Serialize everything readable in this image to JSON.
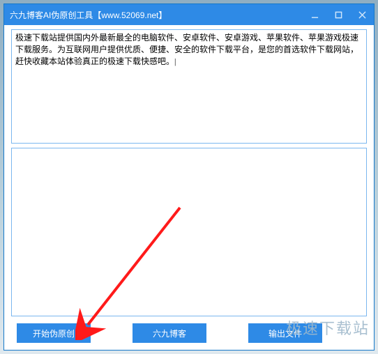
{
  "window": {
    "title": "六九博客AI伪原创工具【www.52069.net】"
  },
  "input_text": "极速下载站提供国内外最新最全的电脑软件、安卓软件、安卓游戏、苹果软件、苹果游戏极速下载服务。为互联网用户提供优质、便捷、安全的软件下载平台，是您的首选软件下载网站，赶快收藏本站体验真正的极速下载快感吧。|",
  "output_text": "",
  "buttons": {
    "start": "开始伪原创",
    "blog": "六九博客",
    "export": "输出文件"
  },
  "watermark": "极速下载站",
  "colors": {
    "accent": "#2e8ae6",
    "border": "#7bb7ef",
    "arrow": "#ff1a1a"
  }
}
